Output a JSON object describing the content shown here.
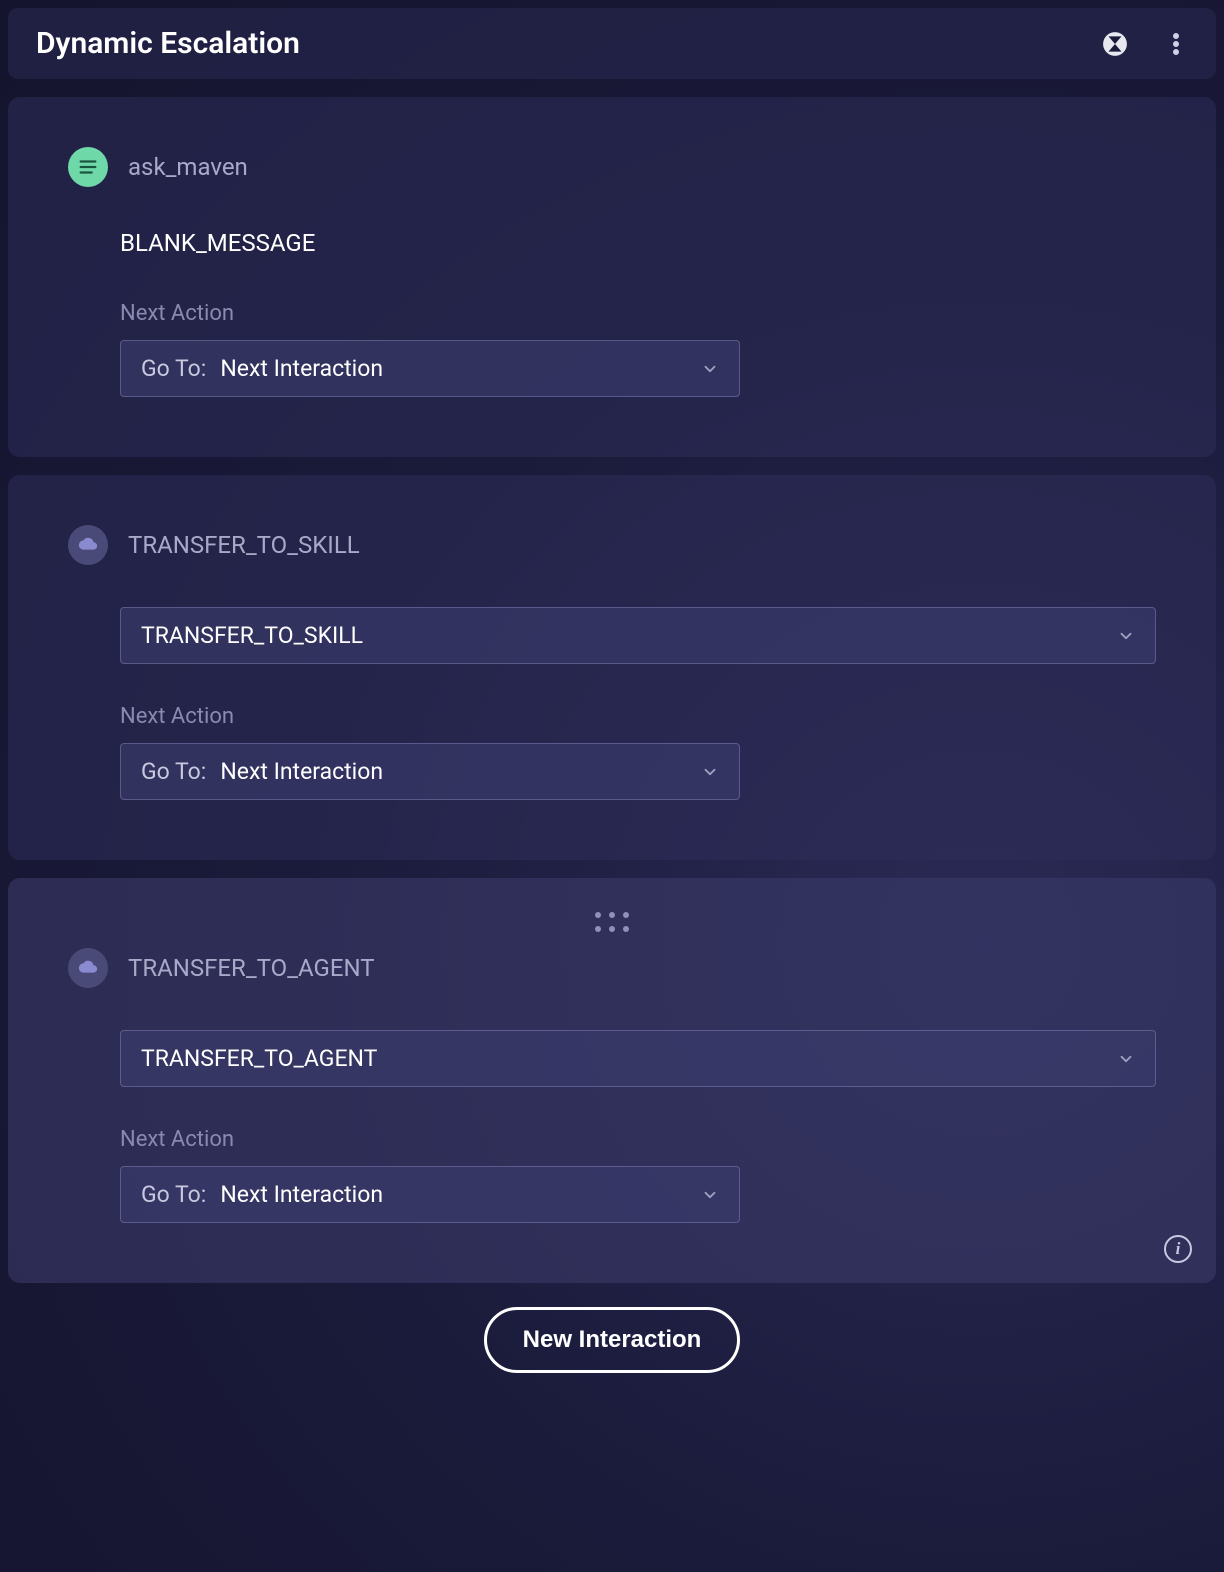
{
  "header": {
    "title": "Dynamic Escalation"
  },
  "cards": [
    {
      "icon": "lines",
      "title": "ask_maven",
      "message": "BLANK_MESSAGE",
      "next_action_label": "Next Action",
      "goto_prefix": "Go To:",
      "goto_value": "Next Interaction"
    },
    {
      "icon": "cloud",
      "title": "TRANSFER_TO_SKILL",
      "select_value": "TRANSFER_TO_SKILL",
      "next_action_label": "Next Action",
      "goto_prefix": "Go To:",
      "goto_value": "Next Interaction"
    },
    {
      "icon": "cloud",
      "title": "TRANSFER_TO_AGENT",
      "select_value": "TRANSFER_TO_AGENT",
      "next_action_label": "Next Action",
      "goto_prefix": "Go To:",
      "goto_value": "Next Interaction"
    }
  ],
  "footer": {
    "new_interaction": "New Interaction"
  }
}
